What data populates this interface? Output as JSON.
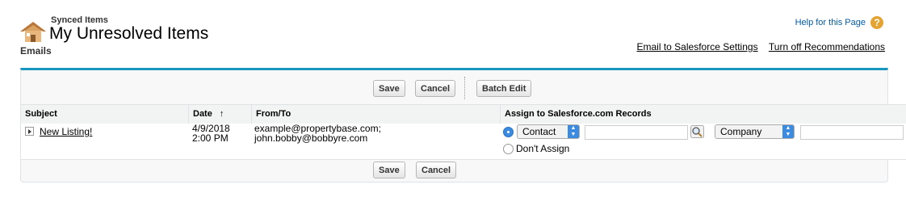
{
  "header": {
    "section": "Synced Items",
    "title": "My Unresolved Items",
    "subtitle": "Emails",
    "help_link": "Help for this Page",
    "help_icon": "question-icon",
    "links": [
      "Email to Salesforce Settings",
      "Turn off Recommendations"
    ]
  },
  "toolbar": {
    "save": "Save",
    "cancel": "Cancel",
    "batch_edit": "Batch Edit"
  },
  "table": {
    "columns": [
      "Subject",
      "Date",
      "From/To",
      "Assign to Salesforce.com Records"
    ],
    "sort_indicator": "↑",
    "rows": [
      {
        "subject": "New Listing!",
        "date_line1": "4/9/2018",
        "date_line2": "2:00 PM",
        "from_line1": "example@propertybase.com;",
        "from_line2": "john.bobby@bobbyre.com",
        "assign_type": "Contact",
        "related_type": "Company",
        "dont_assign": "Don't Assign"
      }
    ]
  },
  "footer": {
    "save": "Save",
    "cancel": "Cancel"
  },
  "colors": {
    "accent": "#1797c0",
    "link": "#015ba7",
    "help_icon": "#e5a331"
  }
}
